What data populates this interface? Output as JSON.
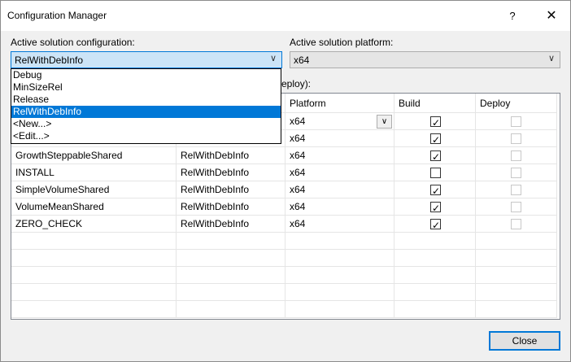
{
  "window": {
    "title": "Configuration Manager",
    "help": "?",
    "close": "✕"
  },
  "config": {
    "label": "Active solution configuration:",
    "value": "RelWithDebInfo"
  },
  "platform": {
    "label": "Active solution platform:",
    "value": "x64"
  },
  "dropdown": {
    "items": [
      "Debug",
      "MinSizeRel",
      "Release",
      "RelWithDebInfo",
      "<New...>",
      "<Edit...>"
    ],
    "selected": "RelWithDebInfo"
  },
  "contexts": {
    "label_tail": "eploy):",
    "columns": {
      "platform": "Platform",
      "build": "Build",
      "deploy": "Deploy"
    },
    "rows": [
      {
        "project": "",
        "configuration": "",
        "platform": "x64",
        "build": true
      },
      {
        "project": "",
        "configuration": "",
        "platform": "x64",
        "build": true
      },
      {
        "project": "GrowthSteppableShared",
        "configuration": "RelWithDebInfo",
        "platform": "x64",
        "build": true
      },
      {
        "project": "INSTALL",
        "configuration": "RelWithDebInfo",
        "platform": "x64",
        "build": false
      },
      {
        "project": "SimpleVolumeShared",
        "configuration": "RelWithDebInfo",
        "platform": "x64",
        "build": true
      },
      {
        "project": "VolumeMeanShared",
        "configuration": "RelWithDebInfo",
        "platform": "x64",
        "build": true
      },
      {
        "project": "ZERO_CHECK",
        "configuration": "RelWithDebInfo",
        "platform": "x64",
        "build": true
      }
    ]
  },
  "buttons": {
    "close": "Close"
  }
}
